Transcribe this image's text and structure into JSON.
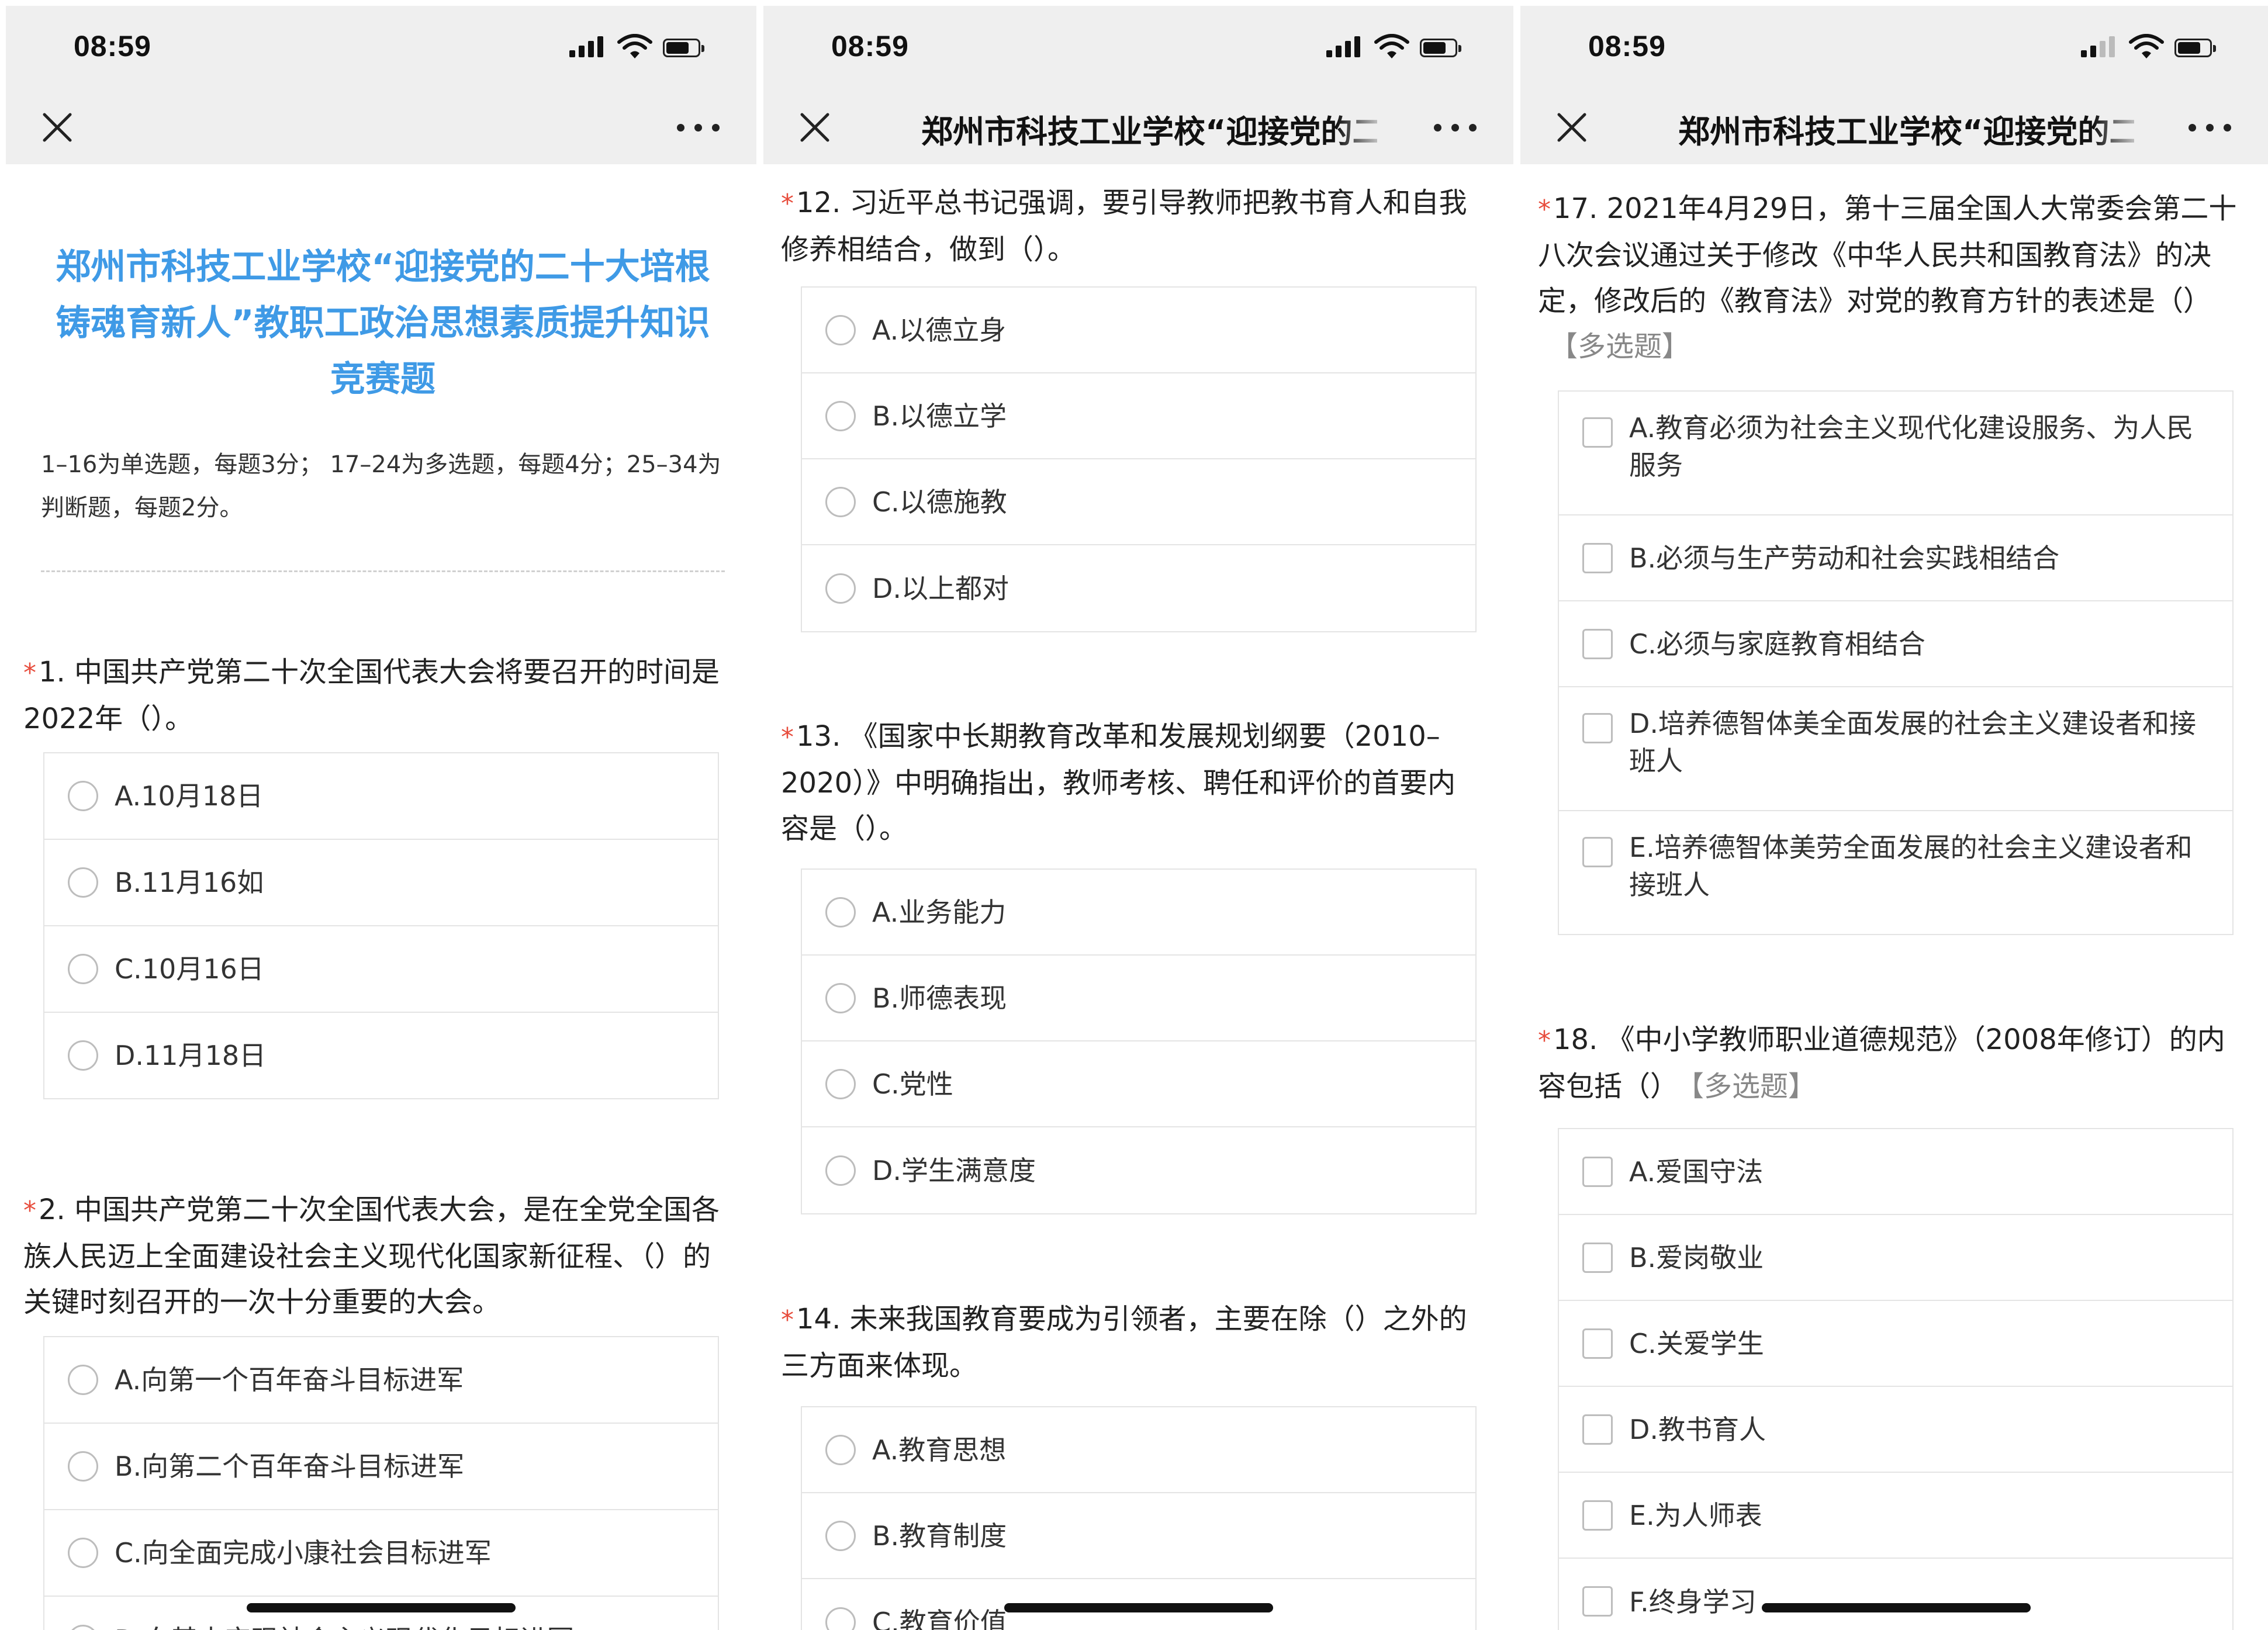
{
  "status": {
    "time": "08:59"
  },
  "nav": {
    "title": "郑州市科技工业学校“迎接党的二十大培根铸魂育新人”教职工政治思想素质提升知识竞赛题"
  },
  "form": {
    "title": "郑州市科技工业学校“迎接党的二十大培根铸魂育新人”教职工政治思想素质提升知识竞赛题",
    "description": "1–16为单选题，每题3分； 17–24为多选题，每题4分；25–34为判断题，每题2分。"
  },
  "panel1": {
    "questions": [
      {
        "star": "*",
        "text": "1. 中国共产党第二十次全国代表大会将要召开的时间是2022年（）。",
        "options": [
          "A.10月18日",
          "B.11月16如",
          "C.10月16日",
          "D.11月18日"
        ]
      },
      {
        "star": "*",
        "text": "2. 中国共产党第二十次全国代表大会，是在全党全国各族人民迈上全面建设社会主义现代化国家新征程、（）的关键时刻召开的一次十分重要的大会。",
        "options": [
          "A.向第一个百年奋斗目标进军",
          "B.向第二个百年奋斗目标进军",
          "C.向全面完成小康社会目标进军",
          "D.向基本实现社会主义现代化目标进军"
        ]
      }
    ]
  },
  "panel2": {
    "questions": [
      {
        "star": "*",
        "text": "12. 习近平总书记强调，要引导教师把教书育人和自我修养相结合，做到（）。",
        "options": [
          "A.以德立身",
          "B.以德立学",
          "C.以德施教",
          "D.以上都对"
        ]
      },
      {
        "star": "*",
        "text": "13. 《国家中长期教育改革和发展规划纲要（2010–2020）》中明确指出，教师考核、聘任和评价的首要内容是（）。",
        "options": [
          "A.业务能力",
          "B.师德表现",
          "C.党性",
          "D.学生满意度"
        ]
      },
      {
        "star": "*",
        "text": "14. 未来我国教育要成为引领者，主要在除（）之外的三方面来体现。",
        "options": [
          "A.教育思想",
          "B.教育制度",
          "C.教育价值"
        ]
      }
    ]
  },
  "panel3": {
    "questions": [
      {
        "star": "*",
        "text": "17. 2021年4月29日，第十三届全国人大常委会第二十八次会议通过关于修改《中华人民共和国教育法》的决定，修改后的《教育法》对党的教育方针的表述是（）",
        "tag": "【多选题】",
        "options": [
          "A.教育必须为社会主义现代化建设服务、为人民服务",
          "B.必须与生产劳动和社会实践相结合",
          "C.必须与家庭教育相结合",
          "D.培养德智体美全面发展的社会主义建设者和接班人",
          "E.培养德智体美劳全面发展的社会主义建设者和接班人"
        ]
      },
      {
        "star": "*",
        "text": "18. 《中小学教师职业道德规范》（2008年修订）的内容包括（）",
        "tag": "【多选题】",
        "options": [
          "A.爱国守法",
          "B.爱岗敬业",
          "C.关爱学生",
          "D.教书育人",
          "E.为人师表",
          "F.终身学习"
        ]
      }
    ]
  }
}
